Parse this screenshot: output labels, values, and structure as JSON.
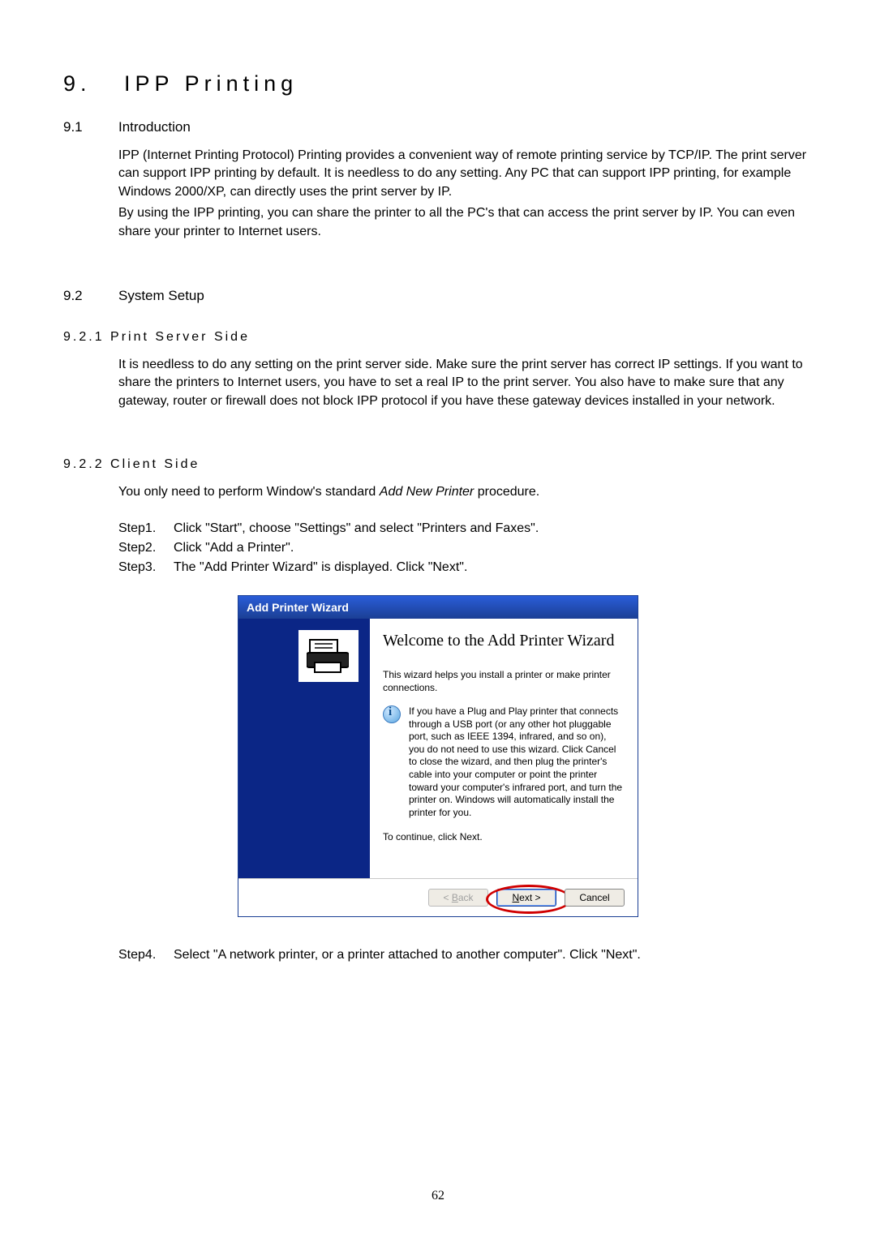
{
  "page_number": "62",
  "chapter": {
    "number": "9.",
    "title": "IPP Printing"
  },
  "sec_9_1": {
    "num": "9.1",
    "title": "Introduction",
    "paragraphs": [
      "IPP (Internet Printing Protocol) Printing provides a convenient way of remote printing service by TCP/IP. The print server can support IPP printing by default. It is needless to do any setting. Any PC that can support IPP printing, for example Windows 2000/XP, can directly uses the print server by IP.",
      "By using the IPP printing, you can share the printer to all the PC's that can access the print server by IP. You can even share your printer to Internet users."
    ]
  },
  "sec_9_2": {
    "num": "9.2",
    "title": "System Setup"
  },
  "sec_9_2_1": {
    "heading": "9.2.1 Print Server Side",
    "paragraph": "It is needless to do any setting on the print server side. Make sure the print server has correct IP settings. If you want to share the printers to Internet users, you have to set a real IP to the print server. You also have to make sure that any gateway, router or firewall does not block IPP protocol if you have these gateway devices installed in your network."
  },
  "sec_9_2_2": {
    "heading": "9.2.2 Client Side",
    "intro_prefix": "You only need to perform Window's standard ",
    "intro_italic": "Add New Printer",
    "intro_suffix": " procedure.",
    "steps": [
      {
        "label": "Step1.",
        "text": "Click \"Start\", choose \"Settings\" and select \"Printers and Faxes\"."
      },
      {
        "label": "Step2.",
        "text": "Click \"Add a Printer\"."
      },
      {
        "label": "Step3.",
        "text": "The \"Add Printer Wizard\" is displayed. Click \"Next\"."
      }
    ],
    "step4": {
      "label": "Step4.",
      "text": "Select \"A network printer, or a printer attached to another computer\". Click \"Next\"."
    }
  },
  "wizard": {
    "title": "Add Printer Wizard",
    "heading": "Welcome to the Add Printer Wizard",
    "intro": "This wizard helps you install a printer or make printer connections.",
    "info": "If you have a Plug and Play printer that connects through a USB port (or any other hot pluggable port, such as IEEE 1394, infrared, and so on), you do not need to use this wizard. Click Cancel to close the wizard, and then plug the printer's cable into your computer or point the printer toward your computer's infrared port, and turn the printer on. Windows will automatically install the printer for you.",
    "continue_text": "To continue, click Next.",
    "buttons": {
      "back_prefix": "< ",
      "back_u": "B",
      "back_suffix": "ack",
      "next_u": "N",
      "next_suffix": "ext >",
      "cancel": "Cancel"
    }
  }
}
